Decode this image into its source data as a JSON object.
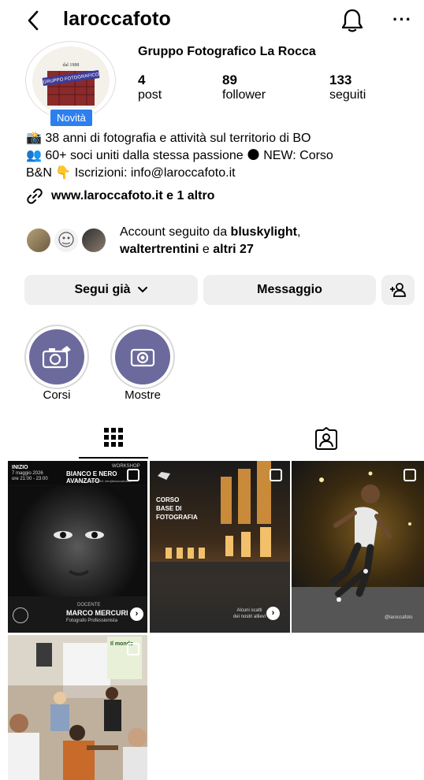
{
  "header": {
    "username": "laroccafoto",
    "back_icon": "chevron-left-icon",
    "bell_icon": "bell-icon",
    "more_label": "···"
  },
  "profile": {
    "avatar_badge": "Novità",
    "avatar_text": "dal 1988",
    "avatar_banner": "GRUPPO FOTOGRAFICO",
    "full_name": "Gruppo Fotografico La Rocca",
    "stats": [
      {
        "value": "4",
        "label": "post"
      },
      {
        "value": "89",
        "label": "follower"
      },
      {
        "value": "133",
        "label": "seguiti"
      }
    ]
  },
  "bio": {
    "line1": "📸 38 anni di fotografia e attività sul territorio di BO",
    "line2": "👥 60+ soci uniti dalla stessa passione 🌑 NEW: Corso",
    "line3": "B&N 👇 Iscrizioni: info@laroccafoto.it"
  },
  "link": {
    "text": "www.laroccafoto.it e 1 altro"
  },
  "followed_by": {
    "prefix": "Account seguito da ",
    "user1": "bluskylight",
    "sep": ",",
    "user2": "waltertrentini",
    "mid": " e ",
    "more": "altri 27"
  },
  "actions": {
    "follow": "Segui già",
    "message": "Messaggio",
    "add_user_icon": "add-user-icon"
  },
  "highlights": [
    {
      "label": "Corsi"
    },
    {
      "label": "Mostre"
    }
  ],
  "tabs": {
    "grid_icon": "grid-icon",
    "tagged_icon": "tagged-person-icon"
  },
  "posts": {
    "post1": {
      "start_label": "INIZIO",
      "date": "7 maggio 2026",
      "time": "ore 21:00 - 23:00",
      "workshop": "WORKSHOP",
      "title": "BIANCO E NERO AVANZATO",
      "info": "INFO E ISCRIZIONI: info@laroccafoto.it",
      "docente": "DOCENTE",
      "name": "MARCO MERCURI",
      "role": "Fotografo Professionista"
    },
    "post2": {
      "line1": "CORSO",
      "line2": "BASE DI",
      "line3": "FOTOGRAFIA",
      "caption1": "Alcuni scatti",
      "caption2": "dei nostri allievi"
    },
    "post3": {
      "watermark": "@laroccafoto"
    },
    "post4": {
      "poster": "Il mondo"
    }
  }
}
